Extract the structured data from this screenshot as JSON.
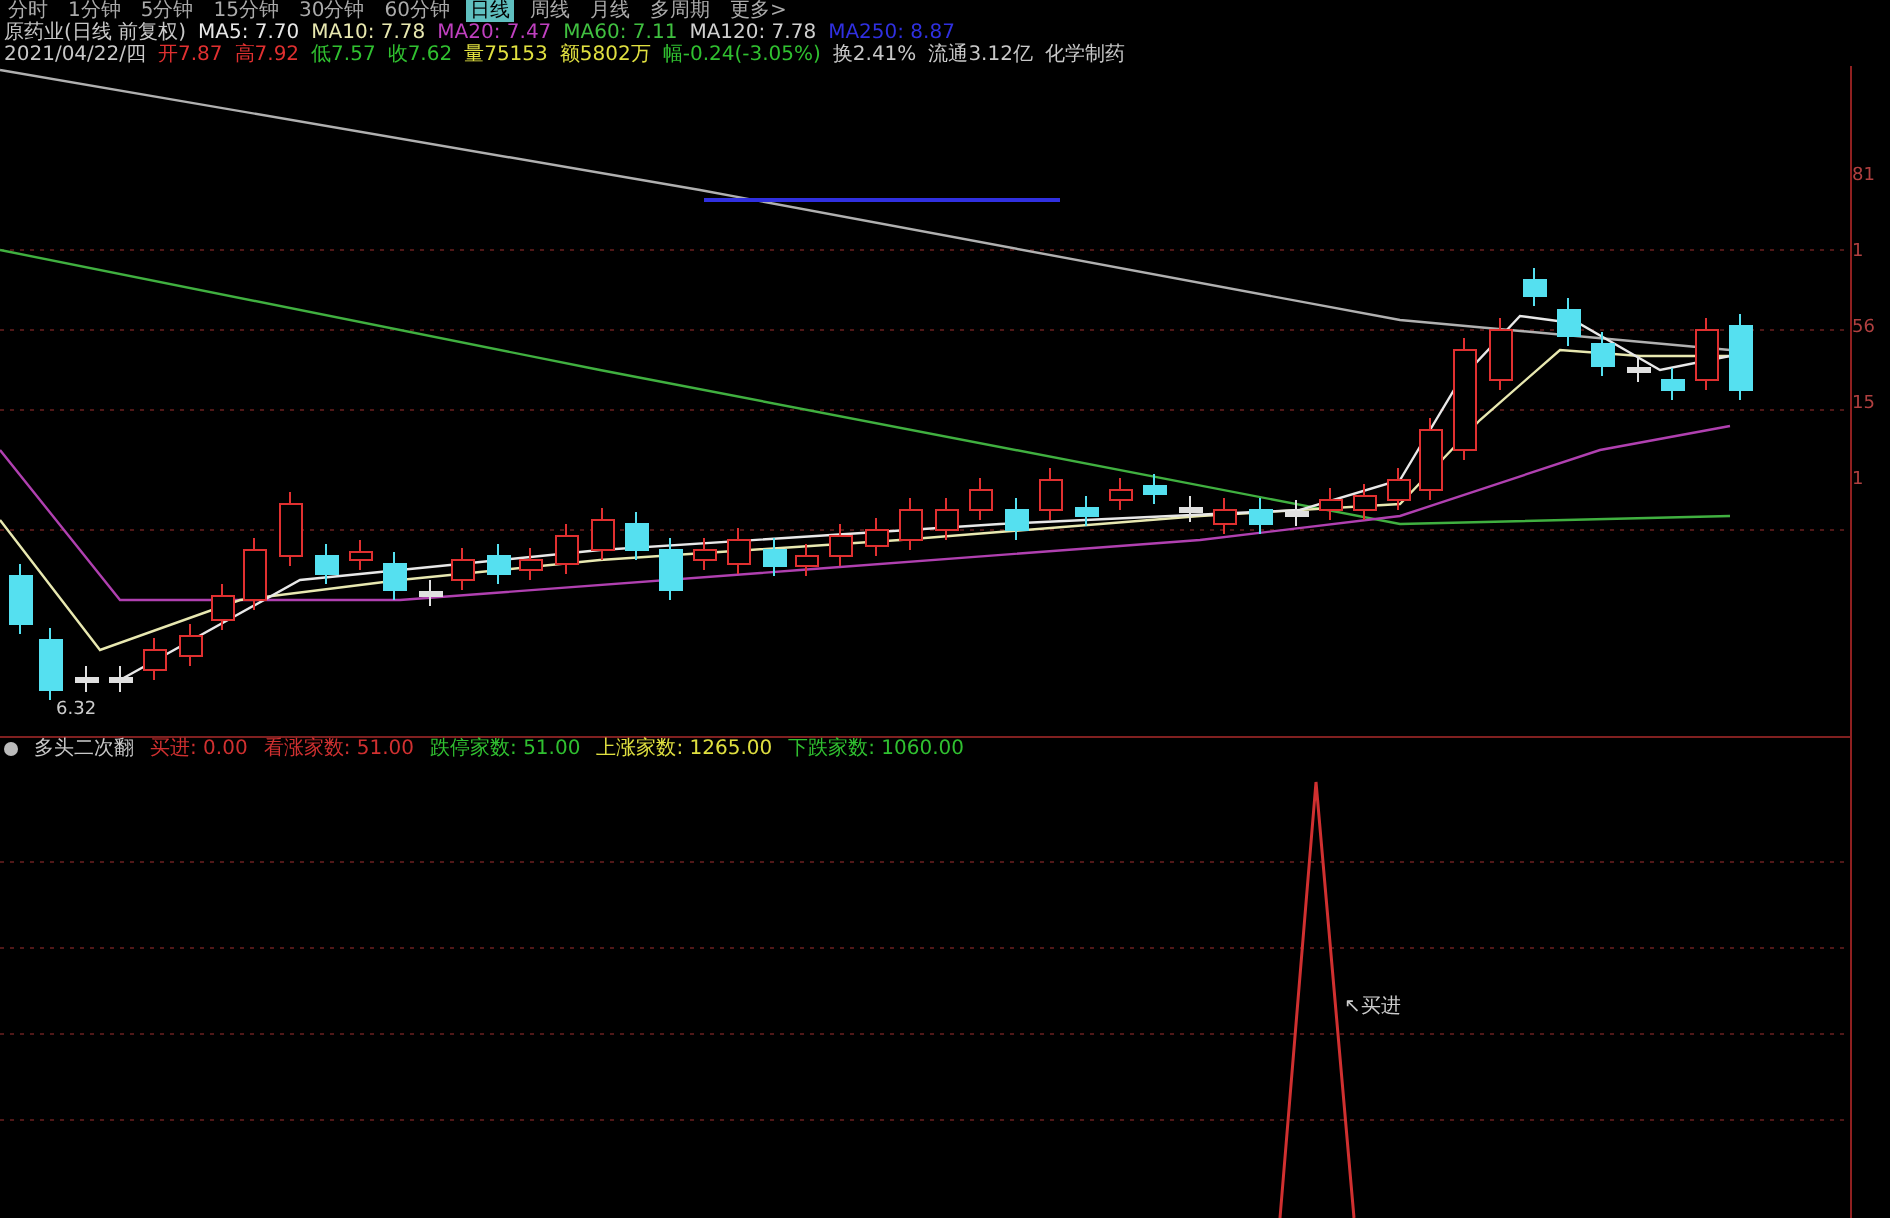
{
  "period_tabs": [
    {
      "label": "分时",
      "selected": false
    },
    {
      "label": "1分钟",
      "selected": false
    },
    {
      "label": "5分钟",
      "selected": false
    },
    {
      "label": "15分钟",
      "selected": false
    },
    {
      "label": "30分钟",
      "selected": false
    },
    {
      "label": "60分钟",
      "selected": false
    },
    {
      "label": "日线",
      "selected": true
    },
    {
      "label": "周线",
      "selected": false
    },
    {
      "label": "月线",
      "selected": false
    },
    {
      "label": "多周期",
      "selected": false
    },
    {
      "label": "更多>",
      "selected": false
    }
  ],
  "quote_header": {
    "title": "原药业(日线 前复权)",
    "indicators": [
      {
        "label": "MA5: 7.70",
        "color": "#e8e8e8"
      },
      {
        "label": "MA10: 7.78",
        "color": "#e8e8b0"
      },
      {
        "label": "MA20: 7.47",
        "color": "#c040c0"
      },
      {
        "label": "MA60: 7.11",
        "color": "#40c040"
      },
      {
        "label": "MA120: 7.78",
        "color": "#d0d0d0"
      },
      {
        "label": "MA250: 8.87",
        "color": "#3030e0"
      }
    ]
  },
  "price_info": [
    {
      "label": "2021/04/22/四",
      "color": "#c8c8c8"
    },
    {
      "label": "开7.87",
      "color": "#e03030"
    },
    {
      "label": "高7.92",
      "color": "#e03030"
    },
    {
      "label": "低7.57",
      "color": "#30c030"
    },
    {
      "label": "收7.62",
      "color": "#30c030"
    },
    {
      "label": "量75153",
      "color": "#e0e040"
    },
    {
      "label": "额5802万",
      "color": "#e0e040"
    },
    {
      "label": "幅-0.24(-3.05%)",
      "color": "#30c030"
    },
    {
      "label": "换2.41%",
      "color": "#c8c8c8"
    },
    {
      "label": "流通3.12亿",
      "color": "#c8c8c8"
    },
    {
      "label": "化学制药",
      "color": "#c8c8c8"
    }
  ],
  "price_axis": [
    "81",
    "1",
    "56",
    "15",
    "1"
  ],
  "low_label": "6.32",
  "indicator_pane": {
    "title": "多头二次翻",
    "values": [
      {
        "label": "买进: 0.00",
        "color": "#d03030"
      },
      {
        "label": "看涨家数: 51.00",
        "color": "#d03030"
      },
      {
        "label": "跌停家数: 51.00",
        "color": "#30c030"
      },
      {
        "label": "上涨家数: 1265.00",
        "color": "#e0e040"
      },
      {
        "label": "下跌家数: 1060.00",
        "color": "#30c030"
      }
    ],
    "signal_label": "↖买进"
  }
}
